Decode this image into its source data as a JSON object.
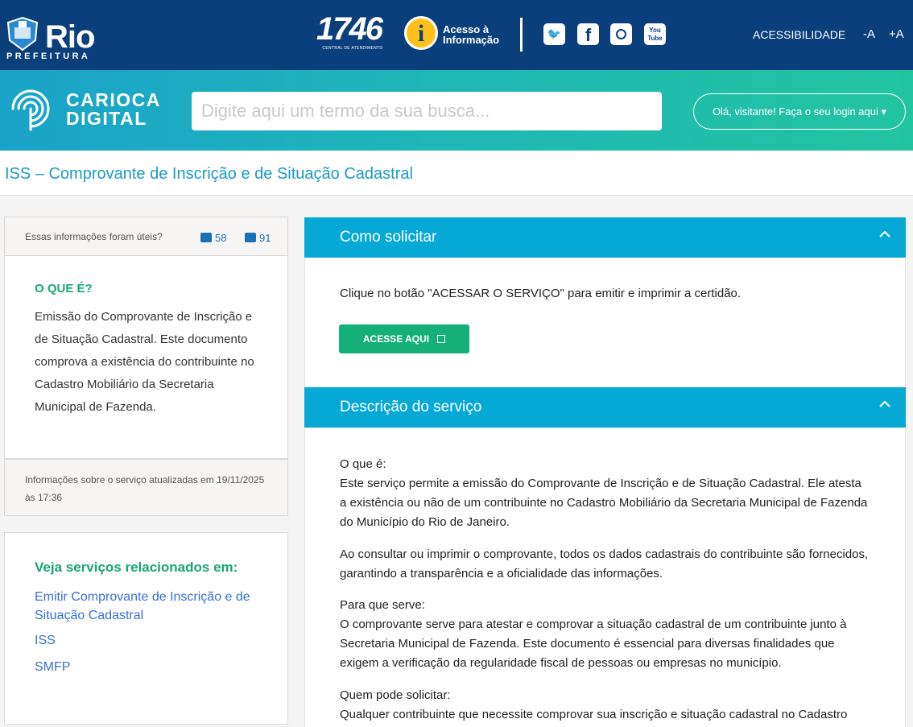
{
  "header": {
    "logo_name": "Rio",
    "logo_sub": "PREFEITURA",
    "hotline_number": "1746",
    "hotline_sub": "CENTRAL DE ATENDIMENTO",
    "info_icon": "i",
    "info_line1": "Acesso à",
    "info_line2": "Informação",
    "accessibility": "ACESSIBILIDADE",
    "font_decrease": "-A",
    "font_increase": "+A",
    "social": [
      "twitter-icon",
      "facebook-icon",
      "instagram-icon",
      "youtube-icon"
    ],
    "youtube_line1": "You",
    "youtube_line2": "Tube",
    "facebook_glyph": "f",
    "twitter_glyph": "🐦"
  },
  "search": {
    "brand_line1": "CARIOCA",
    "brand_line2": "DIGITAL",
    "placeholder": "Digite aqui um termo da sua busca...",
    "login_label": "Olá, visitante! Faça o seu login aqui",
    "login_caret": "▾"
  },
  "page": {
    "title": "ISS – Comprovante de Inscrição e de Situação Cadastral"
  },
  "sidebar": {
    "feedback_question": "Essas informações foram úteis?",
    "likes": "58",
    "dislikes": "91",
    "what_heading": "O QUE É?",
    "what_text": "Emissão do Comprovante de Inscrição e de Situação Cadastral. Este documento comprova a existência do contribuinte no Cadastro Mobiliário da Secretaria Municipal de Fazenda.",
    "updated_text": "Informações sobre o serviço atualizadas em 19/11/2025 às 17:36",
    "related_heading": "Veja serviços relacionados em:",
    "related_links": [
      "Emitir Comprovante de Inscrição e de Situação Cadastral",
      "ISS",
      "SMFP"
    ]
  },
  "main": {
    "request_title": "Como solicitar",
    "request_text": "Clique no botão \"ACESSAR O SERVIÇO\" para emitir e imprimir a certidão.",
    "access_button": "ACESSE AQUI",
    "description_title": "Descrição do serviço",
    "desc_p1": "O que é:\nEste serviço permite a emissão do Comprovante de Inscrição e de Situação Cadastral. Ele atesta a existência ou não de um contribuinte no Cadastro Mobiliário da Secretaria Municipal de Fazenda do Município do Rio de Janeiro.",
    "desc_p2": "Ao consultar ou imprimir o comprovante, todos os dados cadastrais do contribuinte são fornecidos, garantindo a transparência e a oficialidade das informações.",
    "desc_p3": "Para que serve:\nO comprovante serve para atestar e comprovar a situação cadastral de um contribuinte junto à Secretaria Municipal de Fazenda. Este documento é essencial para diversas finalidades que exigem a verificação da regularidade fiscal de pessoas ou empresas no município.",
    "desc_p4": "Quem pode solicitar:\nQualquer contribuinte que necessite comprovar sua inscrição e situação cadastral no Cadastro"
  },
  "colors": {
    "topbar": "#0b3f7b",
    "panel_header": "#06a9d6",
    "accent_green": "#17a673",
    "link_blue": "#3a6fd6"
  }
}
